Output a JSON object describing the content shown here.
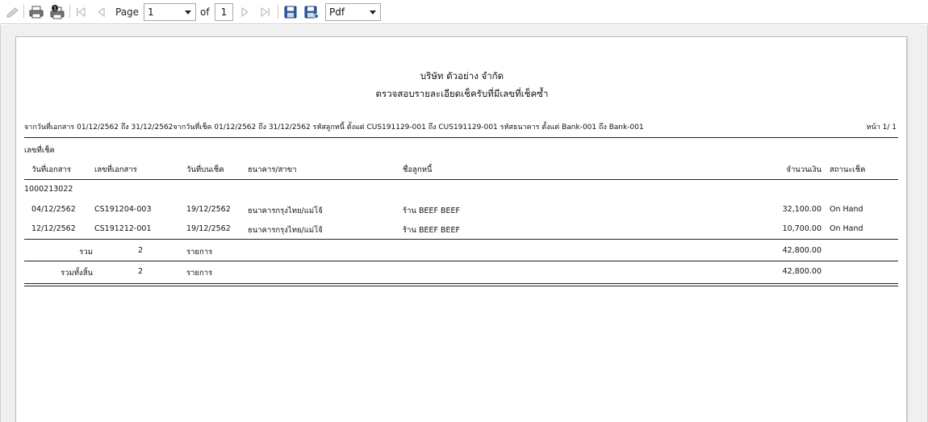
{
  "toolbar": {
    "page_label": "Page",
    "page_value": "1",
    "of_label": "of",
    "total_pages": "1",
    "export_format": "Pdf"
  },
  "report": {
    "company": "บริษัท ตัวอย่าง จำกัด",
    "title": "ตรวจสอบรายละเอียดเช็ครับที่มีเลขที่เช็คซ้ำ",
    "criteria": "จากวันที่เอกสาร 01/12/2562 ถึง 31/12/2562จากวันที่เช็ค 01/12/2562 ถึง 31/12/2562 รหัสลูกหนี้ ตั้งแต่ CUS191129-001 ถึง CUS191129-001 รหัสธนาคาร ตั้งแต่ Bank-001 ถึง Bank-001",
    "page_of": "หน้า 1/ 1",
    "group_header": "เลขที่เช็ค",
    "columns": {
      "doc_date": "วันที่เอกสาร",
      "doc_no": "เลขที่เอกสาร",
      "cheque_date": "วันที่บนเช็ค",
      "bank": "ธนาคาร/สาขา",
      "debtor": "ชื่อลูกหนี้",
      "amount": "จำนวนเงิน",
      "status": "สถานะเช็ค"
    },
    "cheque_no": "1000213022",
    "rows": [
      {
        "doc_date": "04/12/2562",
        "doc_no": "CS191204-003",
        "cheque_date": "19/12/2562",
        "bank": "ธนาคารกรุงไทย/แม่โจ้",
        "debtor": "ร้าน BEEF BEEF",
        "amount": "32,100.00",
        "status": "On Hand"
      },
      {
        "doc_date": "12/12/2562",
        "doc_no": "CS191212-001",
        "cheque_date": "19/12/2562",
        "bank": "ธนาคารกรุงไทย/แม่โจ้",
        "debtor": "ร้าน BEEF BEEF",
        "amount": "10,700.00",
        "status": "On Hand"
      }
    ],
    "subtotal": {
      "label": "รวม",
      "count": "2",
      "unit": "รายการ",
      "amount": "42,800.00"
    },
    "grandtotal": {
      "label": "รวมทั้งสิ้น",
      "count": "2",
      "unit": "รายการ",
      "amount": "42,800.00"
    }
  },
  "icons": {
    "toolbar": [
      "edit-icon",
      "print-icon",
      "print-options-icon",
      "first-page-icon",
      "prev-page-icon",
      "next-page-icon",
      "last-page-icon",
      "save-icon",
      "save-as-icon"
    ]
  }
}
